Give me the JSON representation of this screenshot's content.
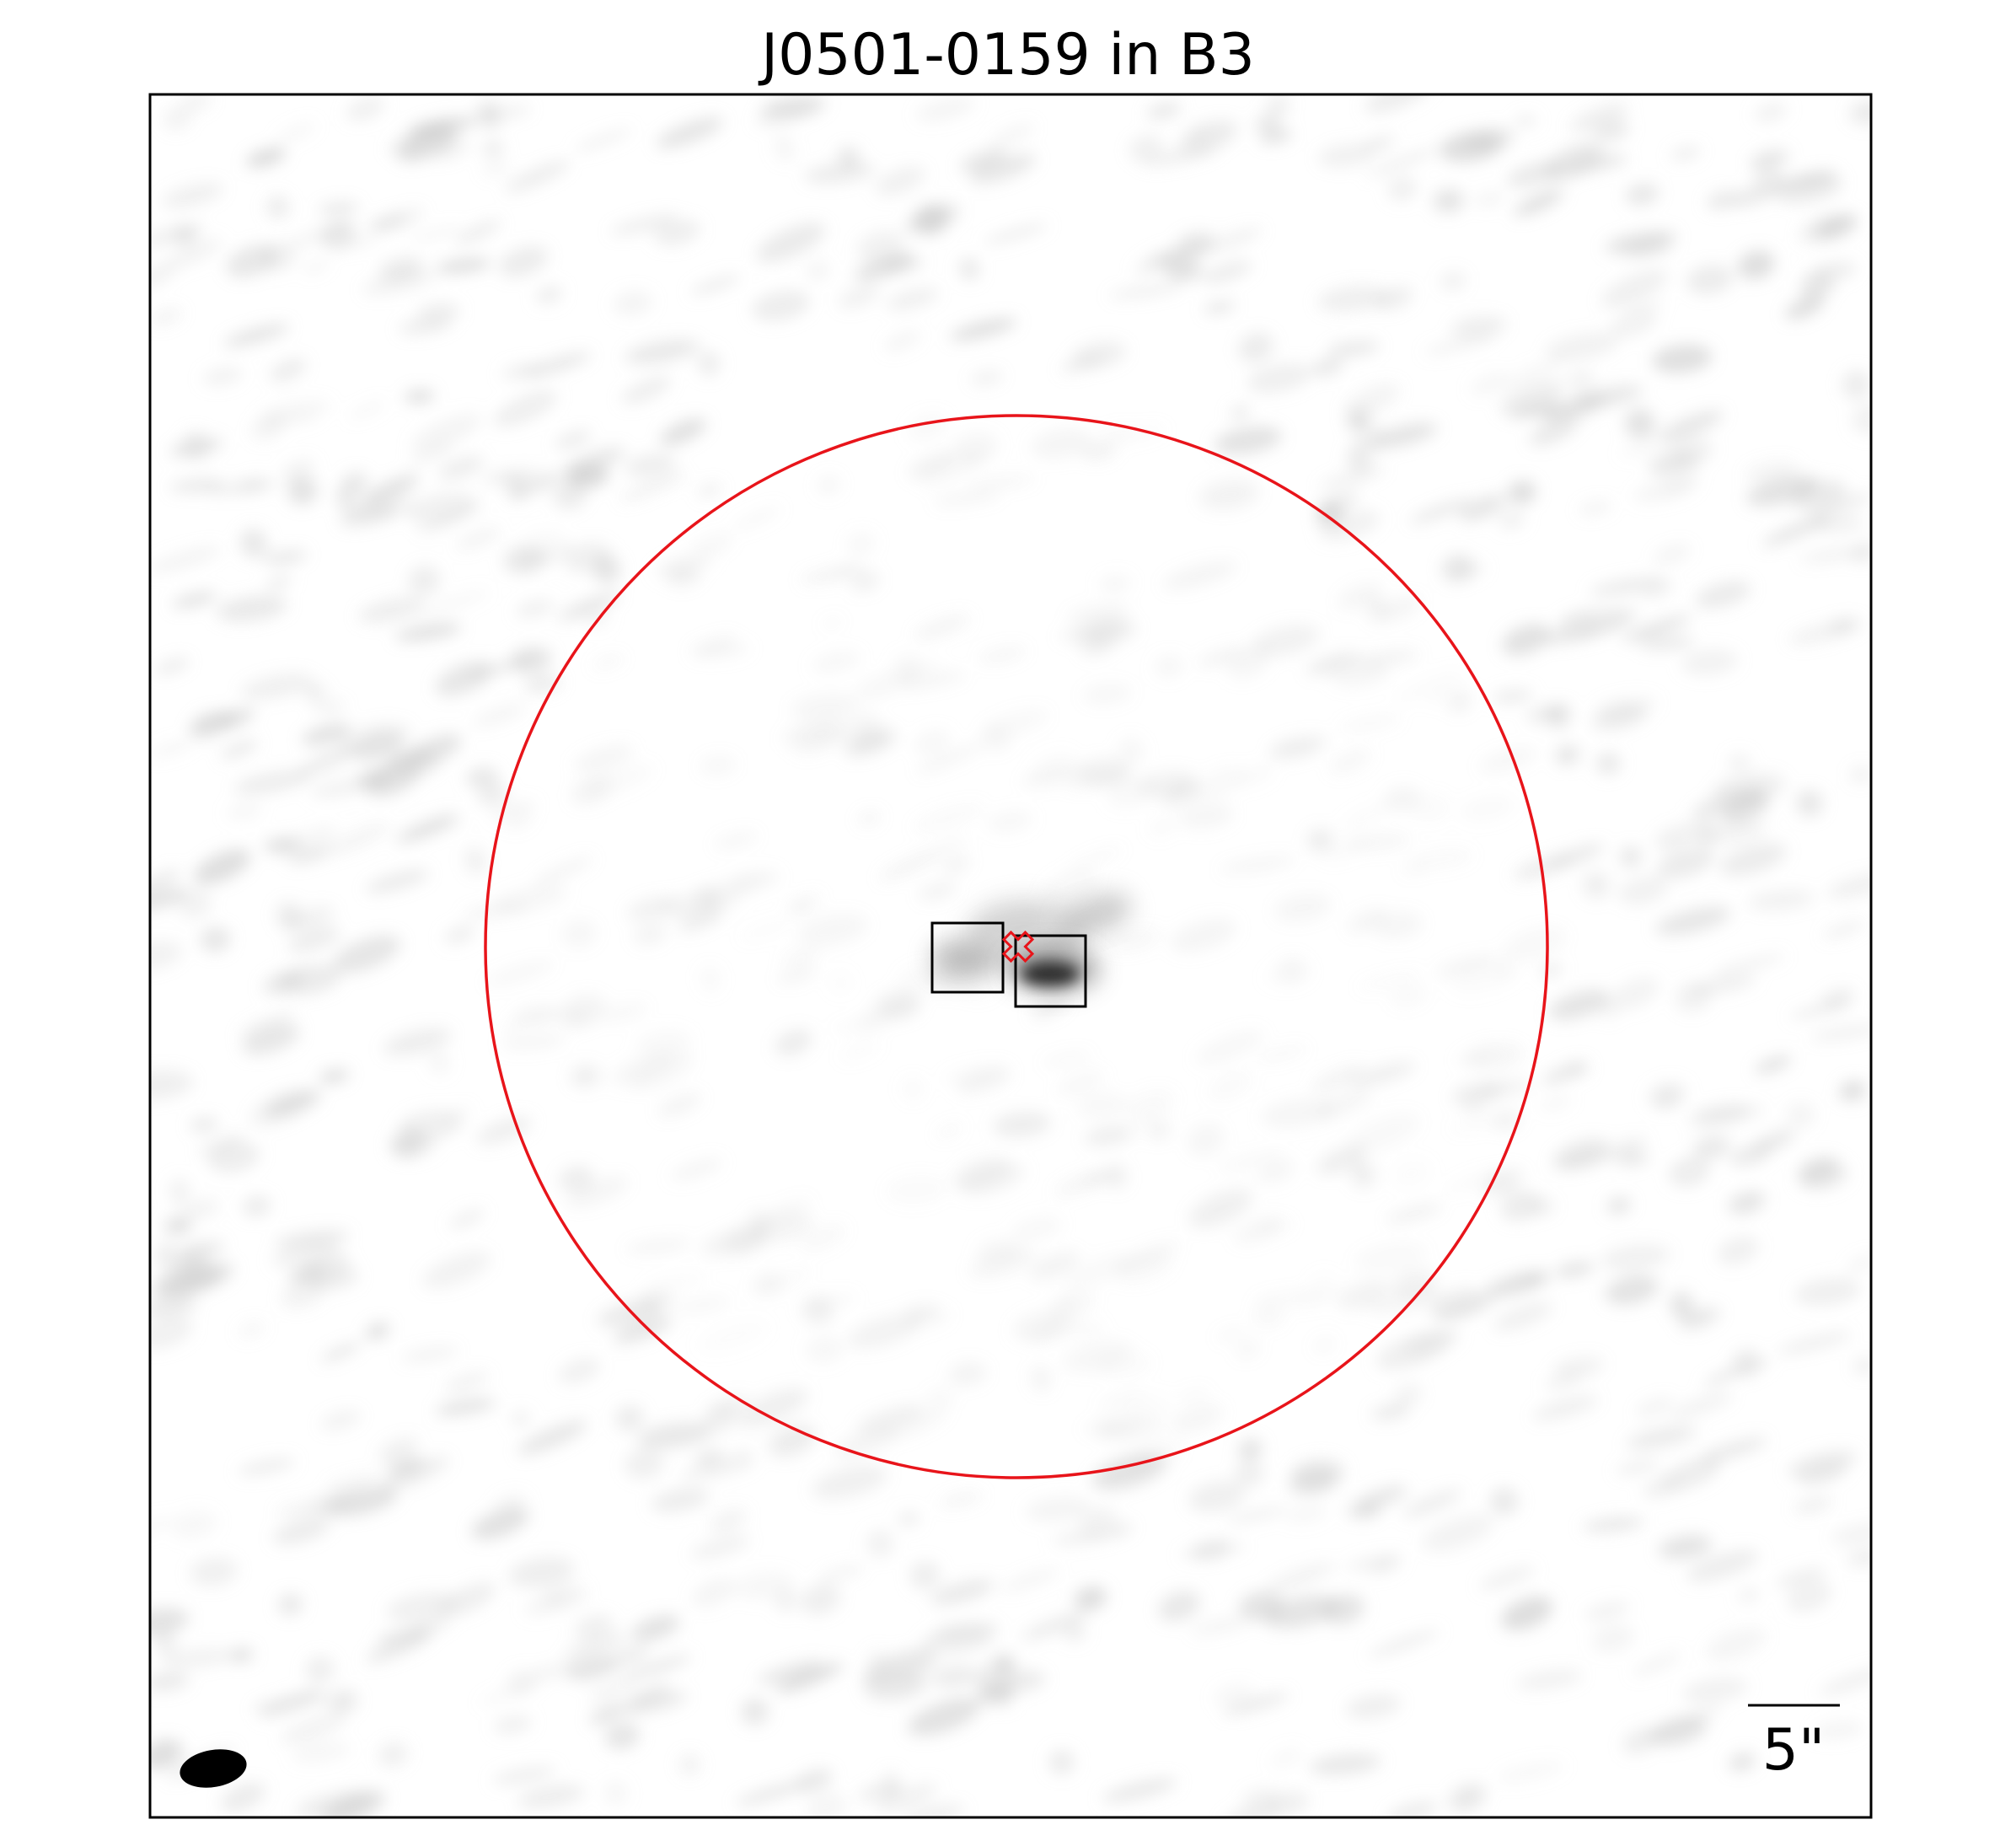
{
  "figure": {
    "title": "J0501-0159 in B3",
    "scale_bar_label": "5\""
  },
  "colors": {
    "frame": "#000000",
    "aperture_circle": "#e8141a",
    "source_marker": "#e8141a",
    "component_box": "#000000",
    "beam": "#000000",
    "background": "#ffffff",
    "noise": "#c8c8c8"
  },
  "image": {
    "colormap": "grayscale-inverted",
    "background_pattern": "faint noise",
    "components": [
      {
        "label": "",
        "brightness": 0.45
      },
      {
        "label": "",
        "brightness": 1.0
      }
    ]
  }
}
